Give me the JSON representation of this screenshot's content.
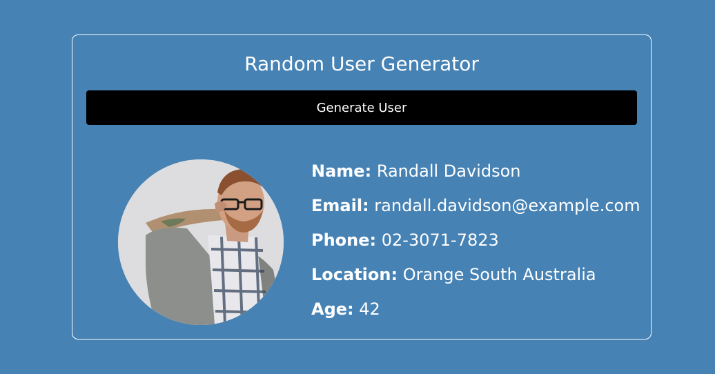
{
  "app": {
    "title": "Random User Generator"
  },
  "actions": {
    "generate_label": "Generate User"
  },
  "user": {
    "fields": [
      {
        "key": "name",
        "label": "Name:",
        "value": "Randall Davidson"
      },
      {
        "key": "email",
        "label": "Email:",
        "value": "randall.davidson@example.com"
      },
      {
        "key": "phone",
        "label": "Phone:",
        "value": "02-3071-7823"
      },
      {
        "key": "location",
        "label": "Location:",
        "value": "Orange South Australia"
      },
      {
        "key": "age",
        "label": "Age:",
        "value": "42"
      }
    ],
    "avatar_icon": "user-photo"
  },
  "colors": {
    "background": "#4682b4",
    "button": "#000000",
    "text": "#ffffff"
  }
}
